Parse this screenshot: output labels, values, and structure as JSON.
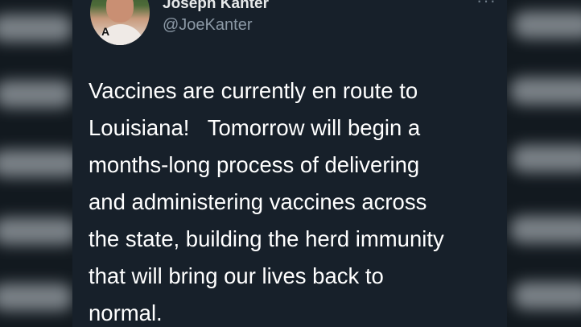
{
  "tweet": {
    "author": {
      "display_name": "Joseph Kanter",
      "handle": "@JoeKanter",
      "avatar_badge": "A"
    },
    "more_icon": "more-horizontal-icon",
    "text_lines": [
      "Vaccines are currently en route to",
      "Louisiana!   Tomorrow will begin a",
      "months-long process of delivering",
      "and administering vaccines across",
      "the state, building the herd immunity",
      "that will bring our lives back to",
      "normal."
    ]
  },
  "colors": {
    "background": "#101820",
    "card": "#17202a",
    "text": "#ffffff",
    "handle": "#8b98a5"
  }
}
